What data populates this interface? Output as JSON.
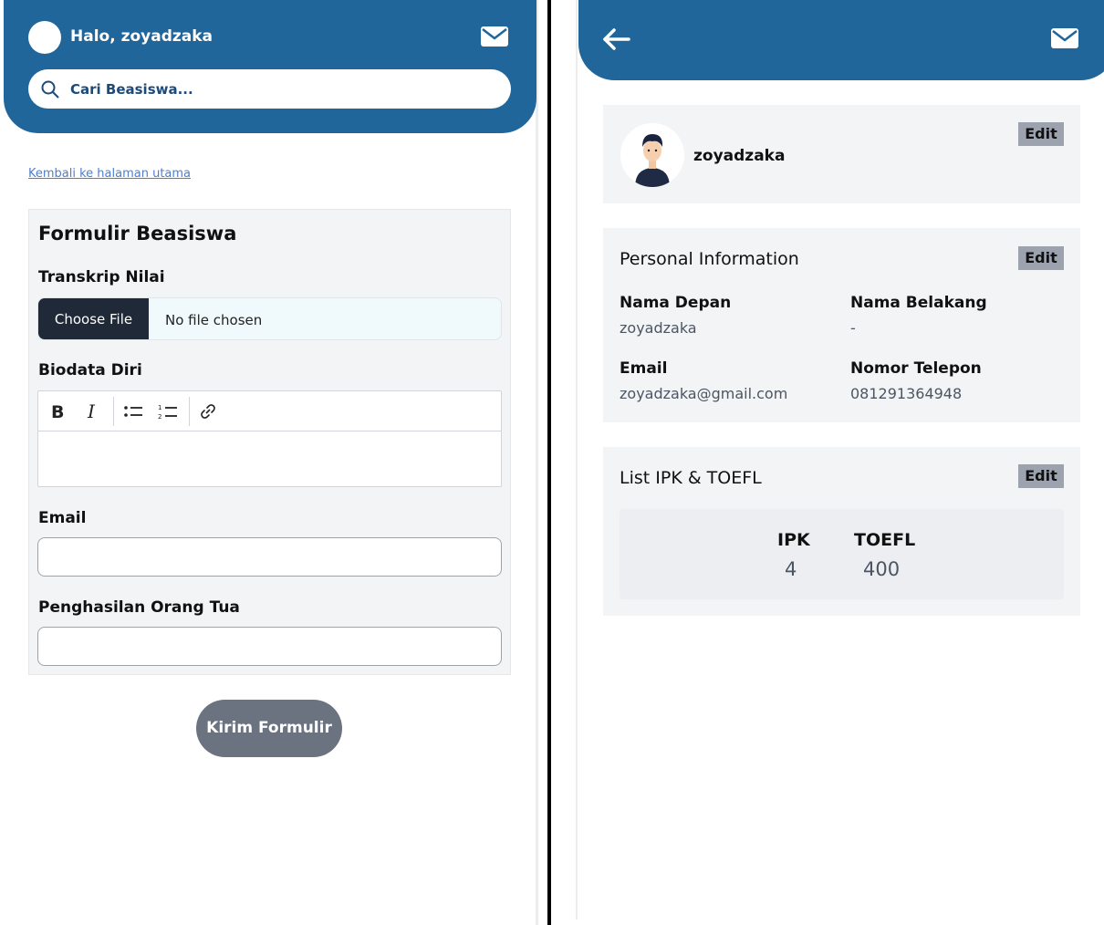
{
  "left": {
    "greeting": "Halo, zoyadzaka",
    "search_placeholder": "Cari Beasiswa...",
    "back_link": "Kembali ke halaman utama",
    "form": {
      "title": "Formulir Beasiswa",
      "transcript_label": "Transkrip Nilai",
      "choose_file": "Choose File",
      "no_file": "No file chosen",
      "biodata_label": "Biodata Diri",
      "email_label": "Email",
      "income_label": "Penghasilan Orang Tua",
      "submit": "Kirim Formulir"
    }
  },
  "right": {
    "profile": {
      "username": "zoyadzaka",
      "edit": "Edit"
    },
    "personal": {
      "title": "Personal Information",
      "edit": "Edit",
      "first_name_label": "Nama Depan",
      "first_name": "zoyadzaka",
      "last_name_label": "Nama Belakang",
      "last_name": "-",
      "email_label": "Email",
      "email": "zoyadzaka@gmail.com",
      "phone_label": "Nomor Telepon",
      "phone": "081291364948"
    },
    "scores": {
      "title": "List IPK & TOEFL",
      "edit": "Edit",
      "ipk_label": "IPK",
      "ipk": "4",
      "toefl_label": "TOEFL",
      "toefl": "400"
    }
  },
  "colors": {
    "header": "#20669a",
    "submit": "#6b7280",
    "edit": "#9ca3af"
  }
}
